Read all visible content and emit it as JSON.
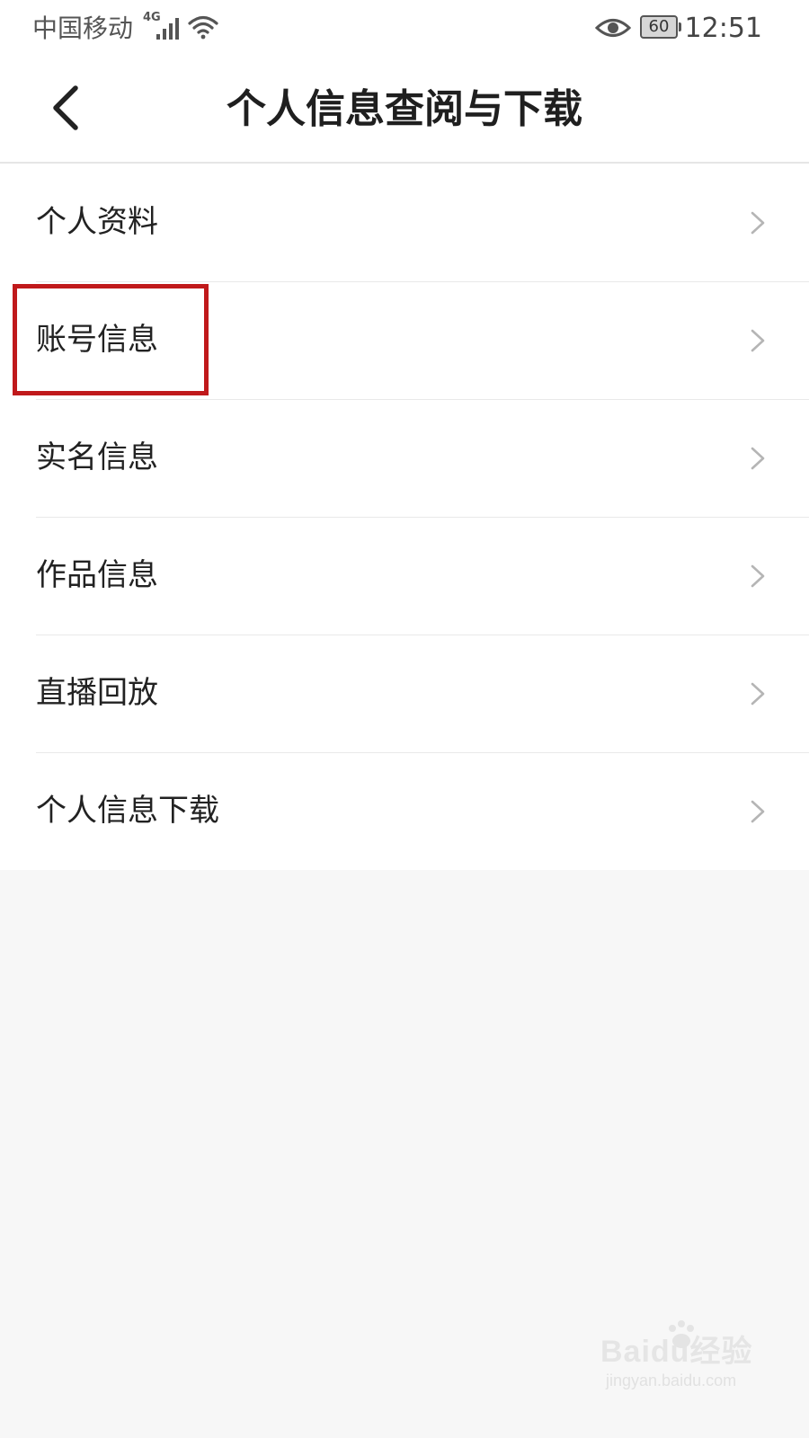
{
  "status_bar": {
    "carrier": "中国移动",
    "network_type": "4G",
    "battery_level": "60",
    "time": "12:51",
    "icons": [
      "signal-icon",
      "wifi-icon",
      "eye-icon",
      "battery-icon"
    ]
  },
  "nav": {
    "title": "个人信息查阅与下载",
    "back_icon": "chevron-left-icon"
  },
  "menu": {
    "items": [
      {
        "label": "个人资料"
      },
      {
        "label": "账号信息"
      },
      {
        "label": "实名信息"
      },
      {
        "label": "作品信息"
      },
      {
        "label": "直播回放"
      },
      {
        "label": "个人信息下载"
      }
    ],
    "highlighted_index": 1,
    "item_icon": "chevron-right-icon"
  },
  "watermark": {
    "brand": "Baidu经验",
    "url": "jingyan.baidu.com"
  },
  "colors": {
    "background": "#f7f7f7",
    "surface": "#ffffff",
    "divider": "#e9e9e9",
    "highlight": "#c0191b",
    "chevron": "#b5b5b5"
  }
}
